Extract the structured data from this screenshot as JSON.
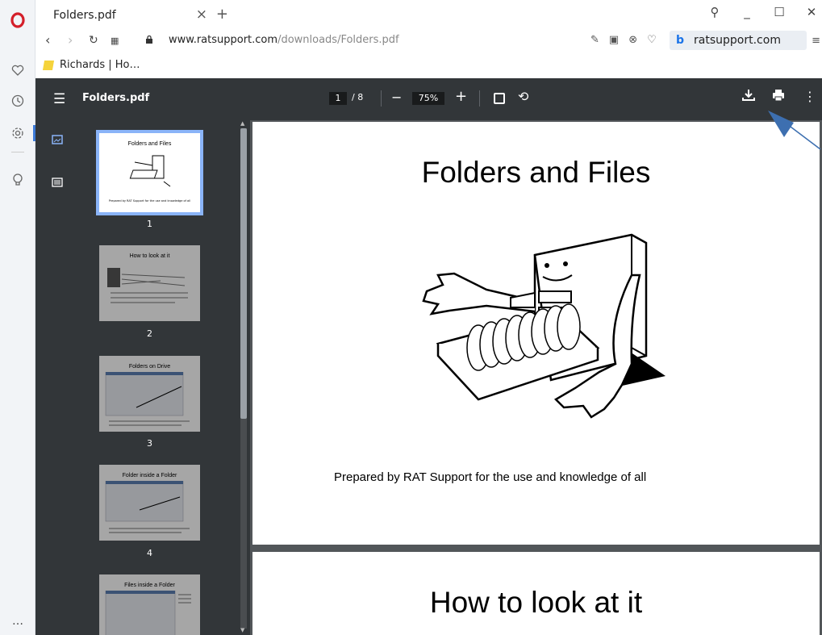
{
  "browser": {
    "tab": {
      "title": "Folders.pdf",
      "close": "×",
      "new": "+"
    },
    "window_controls": {
      "search": "⚲",
      "minimize": "_",
      "maximize": "☐",
      "close": "✕"
    },
    "address": {
      "host": "www.ratsupport.com",
      "path": "/downloads/Folders.pdf"
    },
    "search_box": {
      "engine_letter": "b",
      "text": "ratsupport.com"
    },
    "bookmarks": [
      {
        "label": "Richards | Ho…"
      }
    ],
    "rail_more": "…"
  },
  "pdf": {
    "title": "Folders.pdf",
    "page_current": "1",
    "page_total": "/ 8",
    "zoom": "75%",
    "thumbnails": [
      {
        "num": "1",
        "title": "Folders and Files"
      },
      {
        "num": "2",
        "title": "How to look at it"
      },
      {
        "num": "3",
        "title": "Folders on Drive"
      },
      {
        "num": "4",
        "title": "Folder inside a Folder"
      },
      {
        "num": "",
        "title": "Files inside a Folder"
      }
    ],
    "page1": {
      "heading": "Folders and Files",
      "caption": "Prepared by RAT Support for the use and knowledge of all"
    },
    "page2": {
      "heading": "How to look at it"
    }
  },
  "colors": {
    "toolbar": "#323639",
    "viewer_bg": "#525659",
    "accent": "#8ab4f8",
    "annotation": "#3d6fb0"
  }
}
